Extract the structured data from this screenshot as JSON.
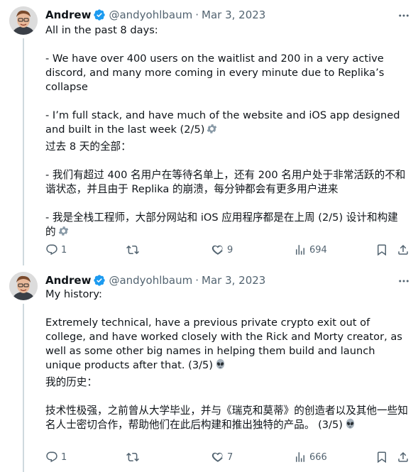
{
  "tweets": [
    {
      "author": {
        "name": "Andrew",
        "handle": "@andyohlbaum",
        "verified": true
      },
      "separator": "·",
      "date": "Mar 3, 2023",
      "paragraphs": [
        "All in the past 8 days:",
        "- We have over 400 users on the waitlist and 200 in a very active discord, and many more coming in every minute due to Replika’s collapse",
        "- I’m full stack, and have much of the website and iOS app designed and built in the last week (2/5)",
        "过去 8 天的全部：",
        "- 我们有超过 400 名用户在等待名单上，还有 200 名用户处于非常活跃的不和谐状态，并且由于 Replika 的崩溃，每分钟都会有更多用户进来",
        "- 我是全栈工程师，大部分网站和 iOS 应用程序都是在上周 (2/5) 设计和构建的"
      ],
      "emoji": "gear-icon",
      "stats": {
        "replies": "1",
        "retweets": "",
        "likes": "9",
        "views": "694"
      }
    },
    {
      "author": {
        "name": "Andrew",
        "handle": "@andyohlbaum",
        "verified": true
      },
      "separator": "·",
      "date": "Mar 3, 2023",
      "paragraphs": [
        "My history:",
        "Extremely technical, have a previous private crypto exit out of college, and have worked closely with the Rick and Morty creator, as well as some other big names in helping them build and launch unique products after that. (3/5)",
        "我的历史：",
        "技术性极强，之前曾从大学毕业，并与《瑞克和莫蒂》的创造者以及其他一些知名人士密切合作，帮助他们在此后构建和推出独特的产品。 (3/5)"
      ],
      "emoji": "alien-icon",
      "stats": {
        "replies": "1",
        "retweets": "",
        "likes": "7",
        "views": "666"
      }
    }
  ],
  "colors": {
    "text": "#0f1419",
    "secondary": "#536471",
    "verified": "#1d9bf0",
    "line": "#cfd9de"
  }
}
